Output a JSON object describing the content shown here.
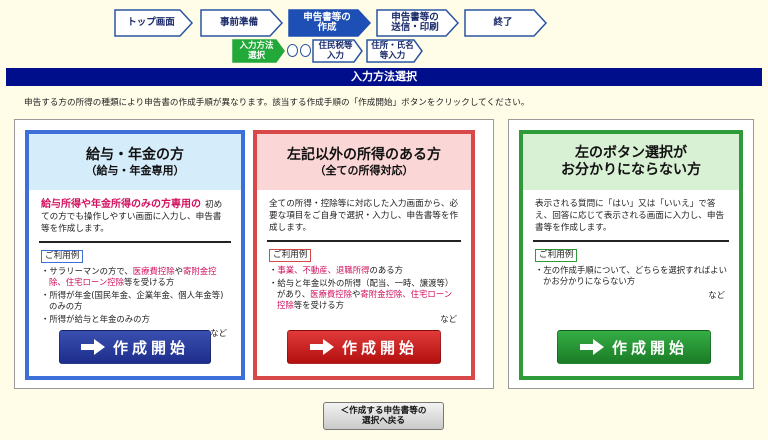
{
  "steps": [
    {
      "label": "トップ画面",
      "state": "done"
    },
    {
      "label": "事前準備",
      "state": "done"
    },
    {
      "label": "申告書等の\n作成",
      "state": "active"
    },
    {
      "label": "申告書等の\n送信・印刷",
      "state": "todo"
    },
    {
      "label": "終了",
      "state": "todo"
    }
  ],
  "substeps": [
    {
      "label": "入力方法\n選択",
      "state": "active"
    },
    {
      "label": "住民税等\n入力",
      "state": "todo"
    },
    {
      "label": "住所・氏名\n等入力",
      "state": "todo"
    }
  ],
  "title": "入力方法選択",
  "instruction": "申告する方の所得の種類により申告書の作成手順が異なります。該当する作成手順の「作成開始」ボタンをクリックしてください。",
  "cards": [
    {
      "heading1": "給与・年金の方",
      "heading2": "（給与・年金専用）",
      "lead": "給与所得や年金所得のみの方専用の",
      "desc": "初めての方でも操作しやすい画面に入力し、申告書等を作成します。",
      "tag": "ご利用例",
      "examples": [
        [
          "サラリーマンの方で、",
          "医療費控除",
          "や",
          "寄附金控除、住宅ローン控除",
          "等を受ける方"
        ],
        [
          "所得が年金(国民年金、企業年金、個人年金等)のみの方"
        ],
        [
          "所得が給与と年金のみの方"
        ]
      ],
      "nado": "など",
      "button": "作成開始",
      "colors": {
        "border": "#3c6fd8",
        "head": "#d5ecfb",
        "button": "#1d2d8c"
      }
    },
    {
      "heading1": "左記以外の所得のある方",
      "heading2": "（全ての所得対応）",
      "desc": "全ての所得・控除等に対応した入力画面から、必要な項目をご自身で選択・入力し、申告書等を作成します。",
      "tag": "ご利用例",
      "examples": [
        [
          "",
          "事業、不動産、退職所得",
          "のある方"
        ],
        [
          "給与と年金以外の所得（配当、一時、譲渡等）があり、",
          "医療費控除",
          "や",
          "寄附金控除、住宅ローン控除",
          "等を受ける方"
        ]
      ],
      "nado": "など",
      "button": "作成開始",
      "colors": {
        "border": "#d84848",
        "head": "#fbd6d6",
        "button": "#c41818"
      }
    },
    {
      "heading1": "左のボタン選択が",
      "heading2": "お分かりにならない方",
      "desc": "表示される質問に「はい」又は「いいえ」で答え、回答に応じて表示される画面に入力し、申告書等を作成します。",
      "tag": "ご利用例",
      "examples": [
        [
          "左の作成手順について、どちらを選択すればよいかお分かりにならない方"
        ]
      ],
      "nado": "など",
      "button": "作成開始",
      "colors": {
        "border": "#2e9a3a",
        "head": "#d8f0d4",
        "button": "#1f8a2c"
      }
    }
  ],
  "back_button": "＜作成する申告書等の\n選択へ戻る"
}
